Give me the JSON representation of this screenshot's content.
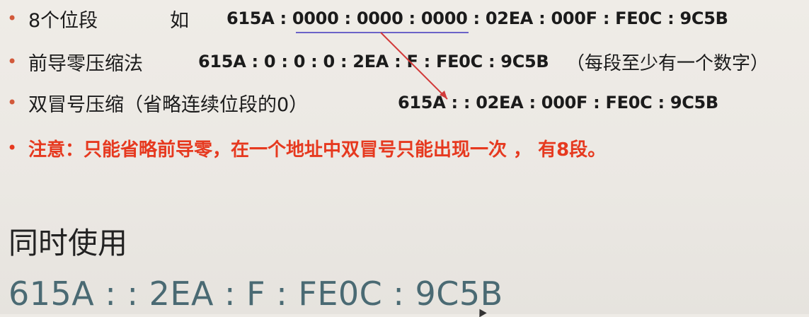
{
  "bullets": [
    {
      "label": "8个位段",
      "prefix": "如",
      "address": "615A : 0000 : 0000 : 0000 : 02EA : 000F : FE0C : 9C5B"
    },
    {
      "label": "前导零压缩法",
      "address": "615A : 0 : 0 : 0 : 2EA : F : FE0C : 9C5B",
      "note": "（每段至少有一个数字）"
    },
    {
      "label": "双冒号压缩（省略连续位段的0）",
      "address": "615A : : 02EA : 000F : FE0C : 9C5B"
    },
    {
      "text": "注意：只能省略前导零，在一个地址中双冒号只能出现一次 ，  有8段。"
    }
  ],
  "section": {
    "heading": "同时使用",
    "address": "615A : : 2EA : F : FE0C : 9C5B"
  },
  "colors": {
    "bullet_dot": "#d2593a",
    "warning_text": "#e6391f",
    "big_address": "#4a6a73",
    "underline": "#6b63c8",
    "arrow": "#d23a3a"
  },
  "icons": {
    "bullet": "•",
    "cursor": "mouse-cursor-icon"
  }
}
